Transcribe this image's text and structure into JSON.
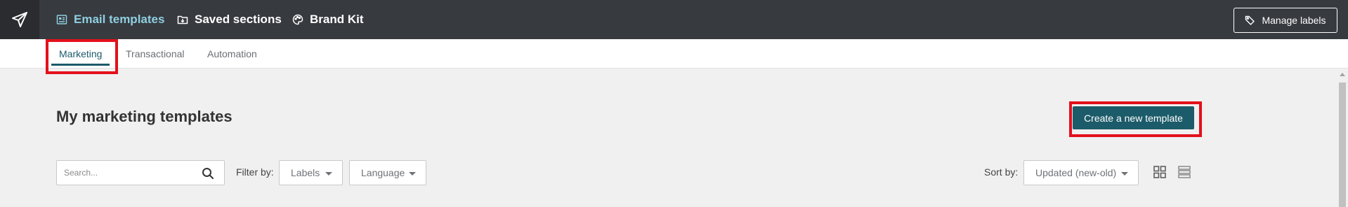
{
  "topbar": {
    "logo_icon": "paper-plane-icon",
    "nav": [
      {
        "label": "Email templates",
        "icon": "template-icon",
        "active": true
      },
      {
        "label": "Saved sections",
        "icon": "folder-download-icon",
        "active": false
      },
      {
        "label": "Brand Kit",
        "icon": "palette-icon",
        "active": false
      }
    ],
    "manage_labels": "Manage labels",
    "manage_icon": "tag-icon"
  },
  "subnav": {
    "tabs": [
      {
        "label": "Marketing",
        "active": true
      },
      {
        "label": "Transactional",
        "active": false
      },
      {
        "label": "Automation",
        "active": false
      }
    ]
  },
  "main": {
    "title": "My marketing templates",
    "create_button": "Create a new template"
  },
  "toolbar": {
    "search_placeholder": "Search...",
    "filter_label": "Filter by:",
    "filters": [
      {
        "label": "Labels"
      },
      {
        "label": "Language"
      }
    ],
    "sort_label": "Sort by:",
    "sort_value": "Updated (new-old)",
    "view_icons": [
      "grid-view-icon",
      "list-view-icon"
    ]
  },
  "colors": {
    "topbar_bg": "#373a3f",
    "active_nav": "#8fcfe0",
    "accent": "#1c5b69",
    "highlight": "#e3101b",
    "page_bg": "#f0f0f0"
  }
}
